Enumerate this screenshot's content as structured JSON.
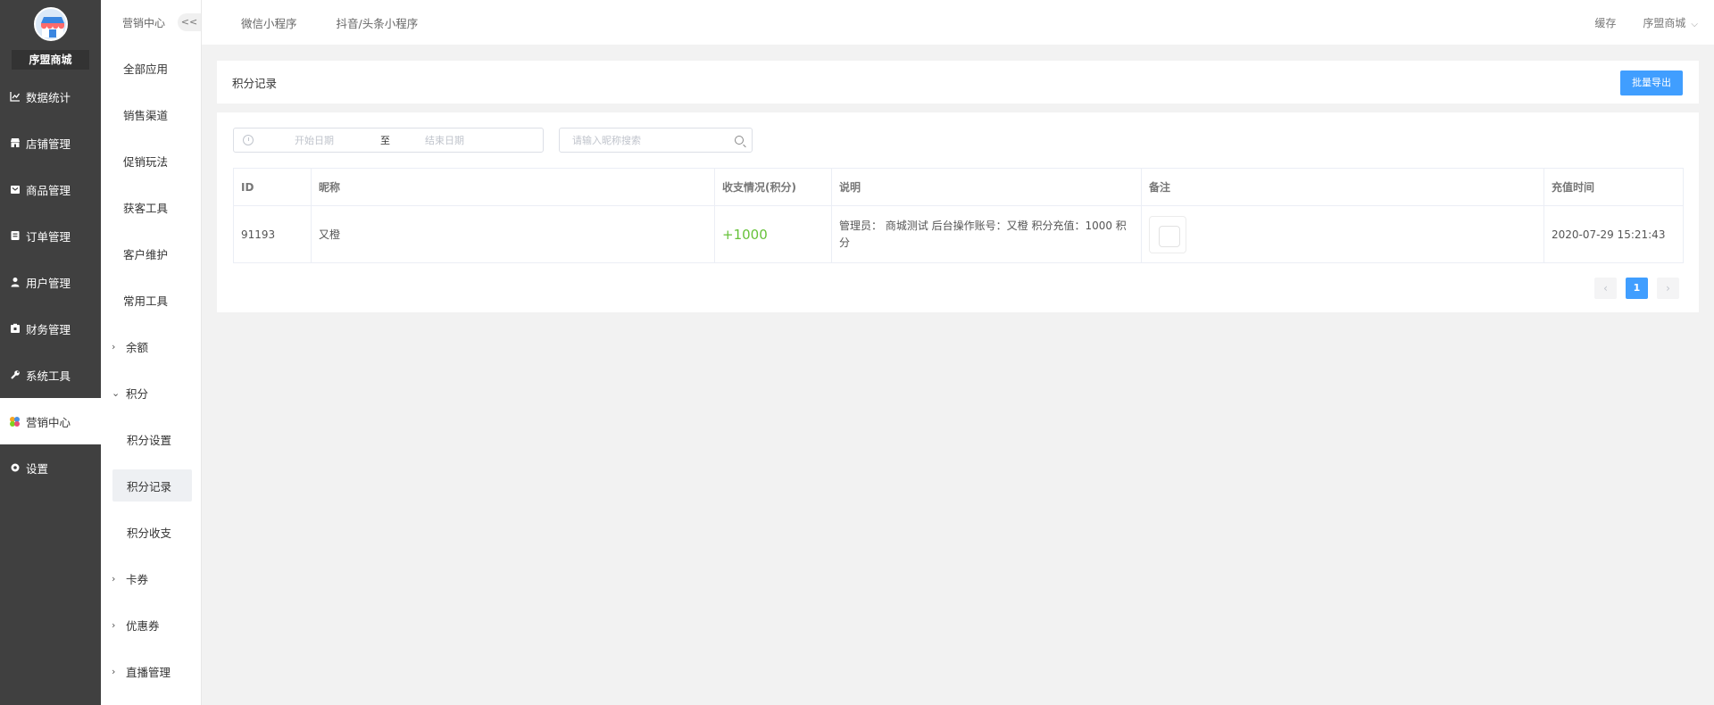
{
  "app": {
    "shop_name": "序盟商城"
  },
  "nav": [
    {
      "label": "数据统计",
      "icon": "chart-icon"
    },
    {
      "label": "店铺管理",
      "icon": "store-icon"
    },
    {
      "label": "商品管理",
      "icon": "box-icon"
    },
    {
      "label": "订单管理",
      "icon": "order-icon"
    },
    {
      "label": "用户管理",
      "icon": "user-icon"
    },
    {
      "label": "财务管理",
      "icon": "wallet-icon"
    },
    {
      "label": "系统工具",
      "icon": "wrench-icon"
    },
    {
      "label": "营销中心",
      "icon": "marketing-icon",
      "active": true
    },
    {
      "label": "设置",
      "icon": "gear-icon"
    }
  ],
  "subnav": {
    "title": "营销中心",
    "collapse_label": "<<",
    "items": [
      {
        "label": "全部应用",
        "type": "item"
      },
      {
        "label": "销售渠道",
        "type": "item"
      },
      {
        "label": "促销玩法",
        "type": "item"
      },
      {
        "label": "获客工具",
        "type": "item"
      },
      {
        "label": "客户维护",
        "type": "item"
      },
      {
        "label": "常用工具",
        "type": "item"
      },
      {
        "label": "余额",
        "type": "group",
        "expanded": false
      },
      {
        "label": "积分",
        "type": "group",
        "expanded": true
      },
      {
        "label": "积分设置",
        "type": "sub"
      },
      {
        "label": "积分记录",
        "type": "sub",
        "selected": true
      },
      {
        "label": "积分收支",
        "type": "sub"
      },
      {
        "label": "卡券",
        "type": "group",
        "expanded": false
      },
      {
        "label": "优惠券",
        "type": "group",
        "expanded": false
      },
      {
        "label": "直播管理",
        "type": "group",
        "expanded": false
      }
    ]
  },
  "topbar": {
    "tabs": [
      "微信小程序",
      "抖音/头条小程序"
    ],
    "cache_label": "缓存",
    "user_label": "序盟商城"
  },
  "page": {
    "title": "积分记录",
    "export_label": "批量导出",
    "filters": {
      "start_placeholder": "开始日期",
      "range_sep": "至",
      "end_placeholder": "结束日期",
      "search_placeholder": "请输入昵称搜索"
    },
    "table": {
      "columns": [
        "ID",
        "昵称",
        "收支情况(积分)",
        "说明",
        "备注",
        "充值时间"
      ],
      "rows": [
        {
          "id": "91193",
          "nickname": "又橙",
          "change": "+1000",
          "desc": "管理员： 商城测试 后台操作账号：又橙 积分充值：1000 积分",
          "note": "",
          "time": "2020-07-29 15:21:43"
        }
      ]
    },
    "pagination": {
      "prev": "‹",
      "current": "1",
      "next": "›"
    }
  },
  "colors": {
    "sidebar_bg": "#404040",
    "accent": "#409eff",
    "positive": "#67c23a"
  }
}
